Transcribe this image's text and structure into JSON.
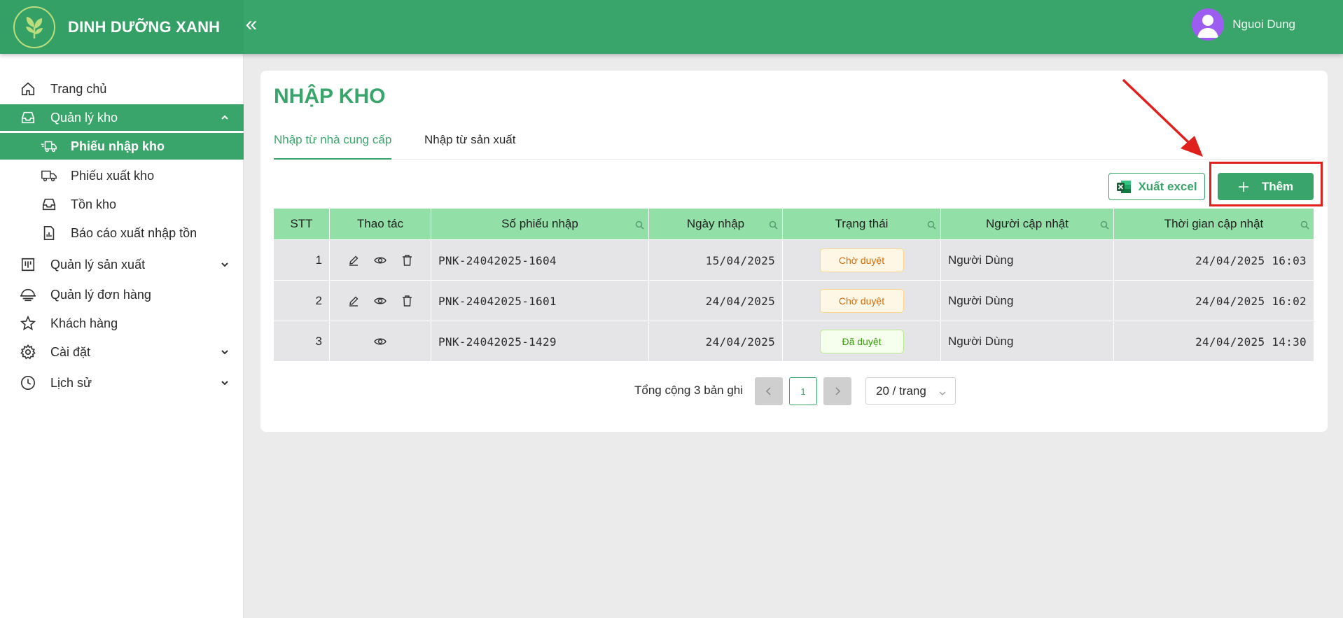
{
  "brand": {
    "name": "DINH DƯỠNG XANH"
  },
  "header": {
    "collapse_icon": "«",
    "user_name": "Nguoi Dung"
  },
  "sidebar": {
    "items": [
      {
        "label": "Trang chủ",
        "icon": "home-icon"
      },
      {
        "label": "Quản lý kho",
        "icon": "inbox-icon",
        "expanded": true
      },
      {
        "label": "Phiếu nhập kho",
        "icon": "truck-in-icon",
        "active": true
      },
      {
        "label": "Phiếu xuất kho",
        "icon": "truck-icon"
      },
      {
        "label": "Tồn kho",
        "icon": "inbox-icon"
      },
      {
        "label": "Báo cáo xuất nhập tồn",
        "icon": "report-icon"
      },
      {
        "label": "Quản lý sản xuất",
        "icon": "factory-icon"
      },
      {
        "label": "Quản lý đơn hàng",
        "icon": "dish-icon"
      },
      {
        "label": "Khách hàng",
        "icon": "star-icon"
      },
      {
        "label": "Cài đặt",
        "icon": "gear-icon"
      },
      {
        "label": "Lịch sử",
        "icon": "clock-icon"
      }
    ]
  },
  "main": {
    "title": "NHẬP KHO",
    "tabs": [
      {
        "label": "Nhập từ nhà cung cấp",
        "active": true
      },
      {
        "label": "Nhập từ sản xuất",
        "active": false
      }
    ],
    "buttons": {
      "export": "Xuất excel",
      "add": "Thêm"
    },
    "table": {
      "columns": [
        "STT",
        "Thao tác",
        "Số phiếu nhập",
        "Ngày nhập",
        "Trạng thái",
        "Người cập nhật",
        "Thời gian cập nhật"
      ],
      "rows": [
        {
          "stt": "1",
          "code": "PNK-24042025-1604",
          "date": "15/04/2025",
          "status": "Chờ duyệt",
          "user": "Người Dùng",
          "updated": "24/04/2025 16:03"
        },
        {
          "stt": "2",
          "code": "PNK-24042025-1601",
          "date": "24/04/2025",
          "status": "Chờ duyệt",
          "user": "Người Dùng",
          "updated": "24/04/2025 16:02"
        },
        {
          "stt": "3",
          "code": "PNK-24042025-1429",
          "date": "24/04/2025",
          "status": "Đã duyệt",
          "user": "Người Dùng",
          "updated": "24/04/2025 14:30"
        }
      ]
    },
    "pagination": {
      "total": "Tổng cộng 3 bản ghi",
      "current_page": "1",
      "page_size": "20 / trang"
    }
  },
  "colors": {
    "primary": "#3aa56b",
    "header_bg": "#3aa56b",
    "table_header": "#92e0a8",
    "annotation": "#e0201d"
  }
}
